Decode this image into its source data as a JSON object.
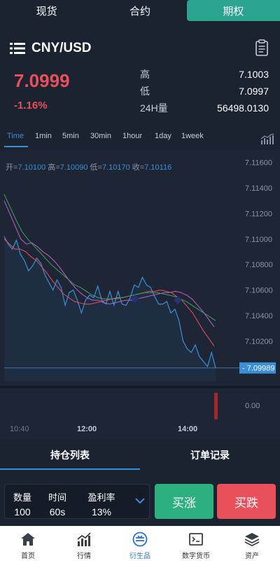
{
  "top_tabs": [
    "现货",
    "合约",
    "期权"
  ],
  "pair": "CNY/USD",
  "price": "7.0999",
  "change": "-1.16%",
  "stats": [
    {
      "label": "高",
      "value": "7.1003"
    },
    {
      "label": "低",
      "value": "7.0997"
    },
    {
      "label": "24H量",
      "value": "56498.0130"
    }
  ],
  "timeframes": [
    "Time",
    "1min",
    "5min",
    "30min",
    "1hour",
    "1day",
    "1week"
  ],
  "ohlc": {
    "open_label": "开=",
    "open": "7.10100",
    "high_label": "高=",
    "high": "7.10090",
    "low_label": "低=",
    "low": "7.10170",
    "close_label": "收=",
    "close": "7.10116"
  },
  "chart_data": {
    "type": "line",
    "y_ticks": [
      "7.11600",
      "7.11400",
      "7.11200",
      "7.11000",
      "7.10800",
      "7.10600",
      "7.10400",
      "7.10200"
    ],
    "current_price_label": "7.09989",
    "volume_tick": "0.00",
    "x_ticks": [
      "10:40",
      "12:00",
      "14:00"
    ],
    "ylim": [
      7.0996,
      7.1162
    ],
    "series": [
      {
        "color": "#3a8fd9",
        "values": [
          7.1102,
          7.1096,
          7.1092,
          7.1099,
          7.1088,
          7.1083,
          7.1075,
          7.1079,
          7.1085,
          7.1081,
          7.1072,
          7.1066,
          7.106,
          7.1068,
          7.1062,
          7.1048,
          7.1058,
          7.106,
          7.1052,
          7.1042,
          7.1052,
          7.1056,
          7.1054,
          7.1063,
          7.1052,
          7.1049,
          7.1059,
          7.1048,
          7.1059,
          7.1049,
          7.1048,
          7.1054,
          7.1064,
          7.1062,
          7.107,
          7.1064,
          7.1062,
          7.1055,
          7.1049,
          7.1049,
          7.1051,
          7.1042,
          7.1045,
          7.1036,
          7.102,
          7.1014,
          7.1011,
          7.1017,
          7.1008,
          7.1004,
          7.1,
          7.1011,
          7.0999
        ]
      },
      {
        "color": "#c65bd1",
        "values": [
          7.113,
          7.112,
          7.111,
          7.11,
          7.1096,
          7.1097,
          7.1094,
          7.109,
          7.1087,
          7.1083,
          7.1078,
          7.1072,
          7.1066,
          7.1061,
          7.1057,
          7.1054,
          7.1052,
          7.1052,
          7.105,
          7.1049,
          7.105,
          7.1051,
          7.1052,
          7.1052,
          7.1053,
          7.1054,
          7.1055,
          7.1056,
          7.1057,
          7.1058,
          7.1058,
          7.1059,
          7.1058,
          7.1056,
          7.1053,
          7.1048,
          7.1043,
          7.1037,
          7.1031
        ]
      },
      {
        "color": "#e8505b",
        "values": [
          7.11,
          7.1096,
          7.1092,
          7.1092,
          7.109,
          7.1086,
          7.1083,
          7.1078,
          7.1073,
          7.1067,
          7.1062,
          7.1057,
          7.1054,
          7.1051,
          7.105,
          7.1049,
          7.1049,
          7.105,
          7.1051,
          7.1052,
          7.1053,
          7.1054,
          7.1054,
          7.1055,
          7.1056,
          7.1057,
          7.1058,
          7.1059,
          7.1059,
          7.106,
          7.1059,
          7.1058,
          7.1055,
          7.1052,
          7.1047,
          7.1042,
          7.1035,
          7.1028,
          7.1022,
          7.1016
        ]
      },
      {
        "color": "#3aa35b",
        "values": [
          7.1135,
          7.1125,
          7.1115,
          7.1106,
          7.11,
          7.1095,
          7.109,
          7.1085,
          7.108,
          7.1076,
          7.1072,
          7.1068,
          7.1064,
          7.1062,
          7.1059,
          7.1056,
          7.1054,
          7.1053,
          7.1053,
          7.1053,
          7.1054,
          7.1055,
          7.1056,
          7.1057,
          7.1058,
          7.1058,
          7.1058,
          7.1057,
          7.1056,
          7.1055,
          7.1053,
          7.1051,
          7.1048,
          7.1045,
          7.1042,
          7.1039,
          7.1036
        ]
      }
    ],
    "volume_bar": {
      "value": 1,
      "color": "#a5262d"
    }
  },
  "position_tabs": [
    "持仓列表",
    "订单记录"
  ],
  "order": [
    {
      "label": "数量",
      "value": "100"
    },
    {
      "label": "时间",
      "value": "60s"
    },
    {
      "label": "盈利率",
      "value": "13%"
    }
  ],
  "buy_up": "买涨",
  "buy_down": "买跌",
  "bottom_nav": [
    "首页",
    "行情",
    "衍生品",
    "数字货币",
    "资产"
  ]
}
